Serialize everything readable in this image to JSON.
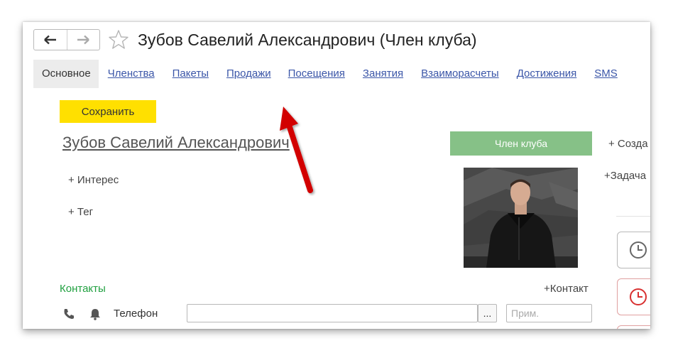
{
  "window": {
    "title": "Зубов Савелий Александрович (Член клуба)"
  },
  "nav": {
    "back_icon": "arrow-left-icon",
    "forward_icon": "arrow-right-icon",
    "favorite_icon": "star-icon"
  },
  "tabs": [
    {
      "label": "Основное",
      "active": true
    },
    {
      "label": "Членства"
    },
    {
      "label": "Пакеты"
    },
    {
      "label": "Продажи"
    },
    {
      "label": "Посещения"
    },
    {
      "label": "Занятия"
    },
    {
      "label": "Взаиморасчеты"
    },
    {
      "label": "Достижения"
    },
    {
      "label": "SMS"
    }
  ],
  "toolbar": {
    "save_label": "Сохранить"
  },
  "client": {
    "full_name": "Зубов Савелий Александрович",
    "status": "Член клуба",
    "add_interest": "+ Интерес",
    "add_tag": "+ Тег"
  },
  "right_panel": {
    "create_label": "+ Созда",
    "task_label": "+Задача"
  },
  "contacts": {
    "section_label": "Контакты",
    "add_contact": "+Контакт",
    "phone_label": "Телефон",
    "phone_value": "",
    "select_button": "...",
    "note_placeholder": "Прим."
  },
  "colors": {
    "save_button": "#ffe000",
    "status_badge": "#86c187",
    "tab_link": "#3b56a8",
    "contacts_label": "#20a040",
    "annotation_arrow": "#d20000"
  }
}
